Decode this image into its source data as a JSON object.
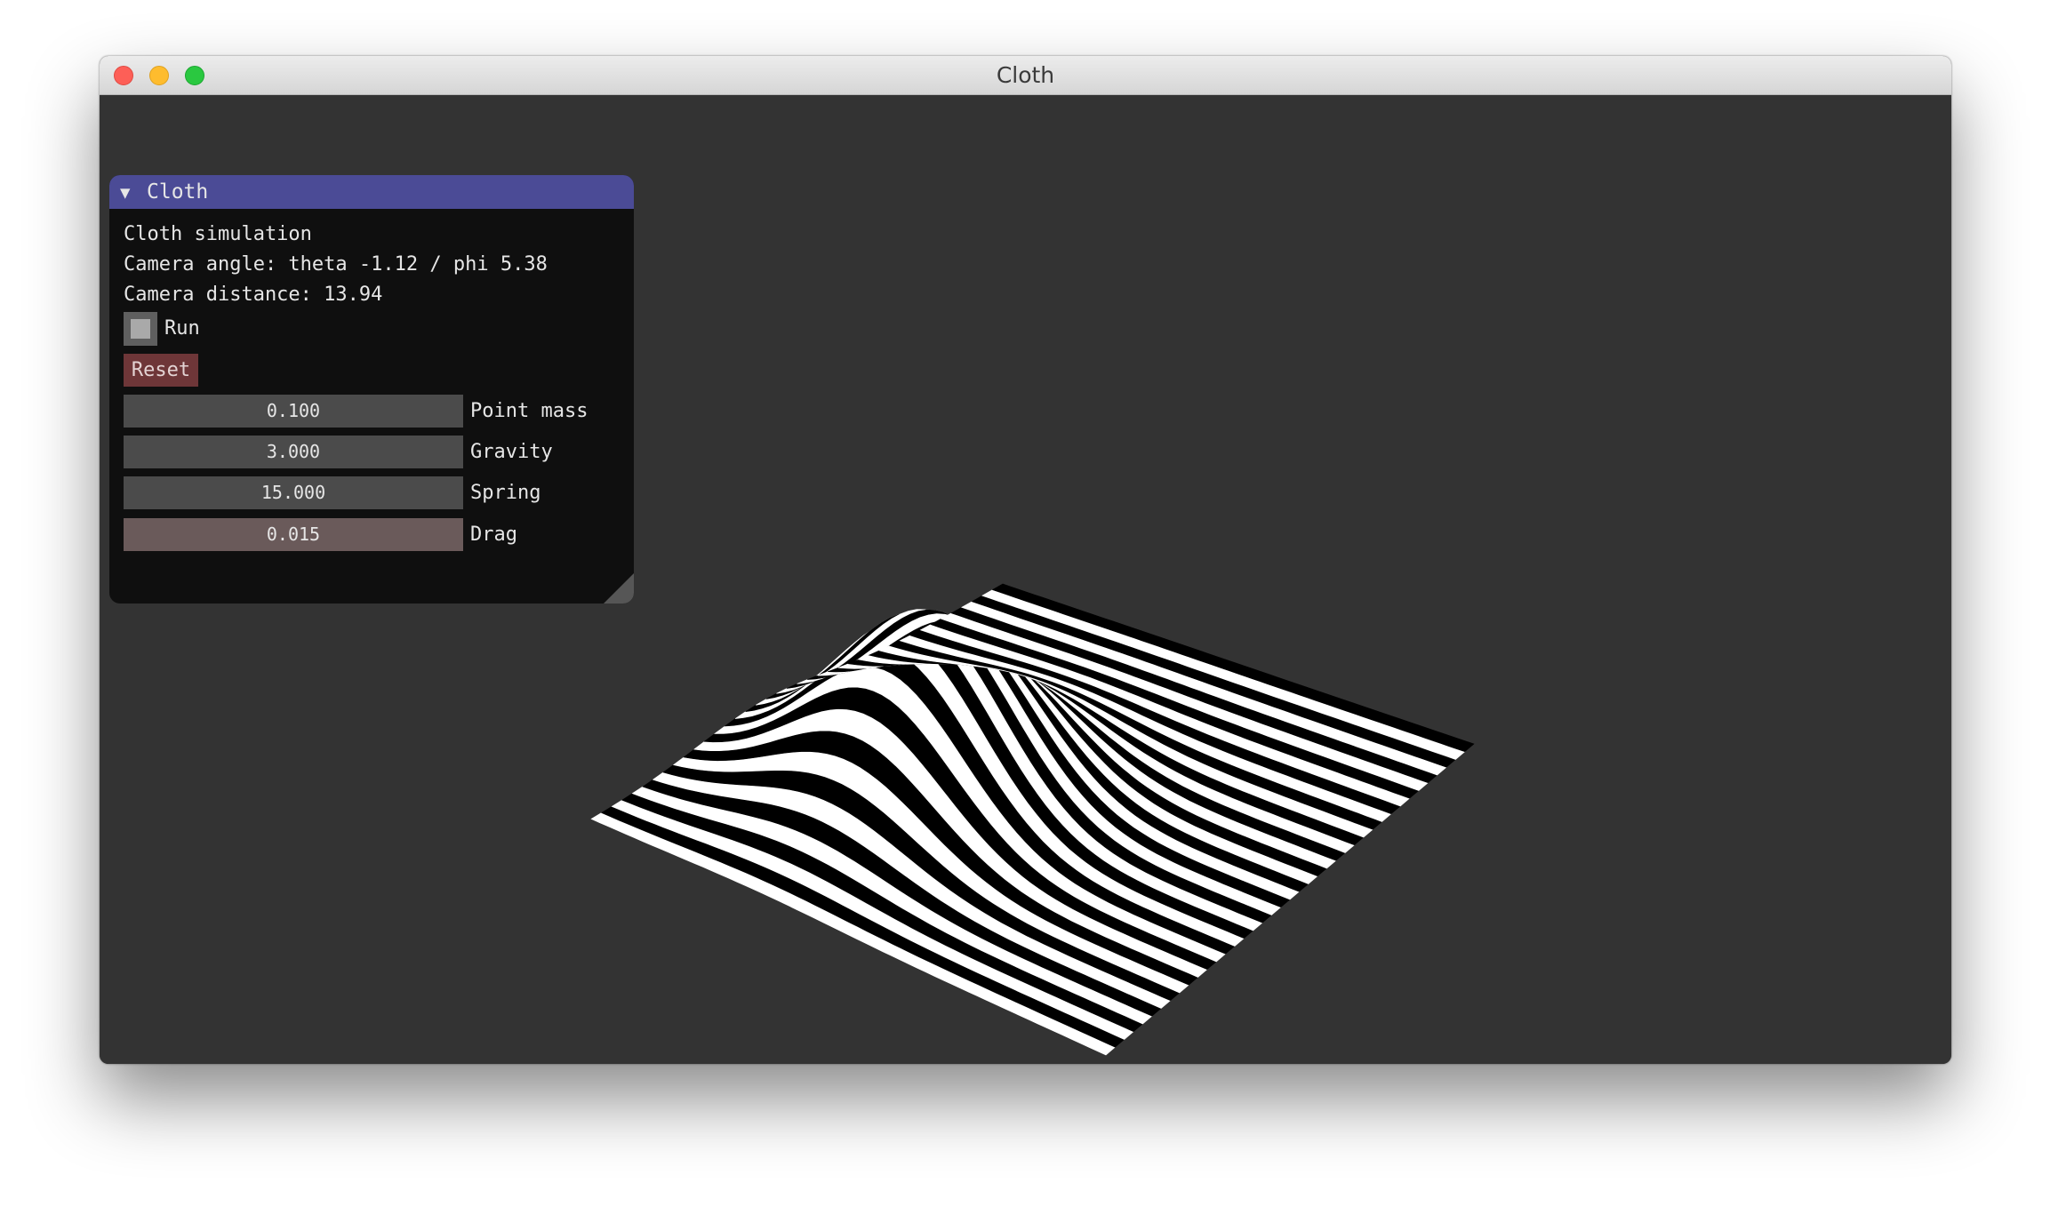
{
  "window": {
    "title": "Cloth"
  },
  "panel": {
    "header_title": "Cloth",
    "lines": {
      "simulation": "Cloth simulation",
      "camera_angle": "Camera angle: theta -1.12 / phi 5.38",
      "camera_distance": "Camera distance: 13.94"
    },
    "run_label": "Run",
    "run_checked": false,
    "reset_label": "Reset",
    "sliders": [
      {
        "value": "0.100",
        "label": "Point mass"
      },
      {
        "value": "3.000",
        "label": "Gravity"
      },
      {
        "value": "15.000",
        "label": "Spring"
      },
      {
        "value": "0.015",
        "label": "Drag"
      }
    ]
  },
  "colors": {
    "background": "#333333",
    "panel_header": "#4b4b96",
    "reset_button": "#6e3638",
    "slider": "#4b4b4b",
    "slider_active": "#6a5a5a",
    "cloth_light": "#ffffff",
    "cloth_dark": "#000000"
  },
  "icons": {
    "collapse": "triangle-down-icon",
    "close": "close-icon",
    "minimize": "minimize-icon",
    "maximize": "maximize-icon",
    "resize": "resize-grip-icon"
  }
}
